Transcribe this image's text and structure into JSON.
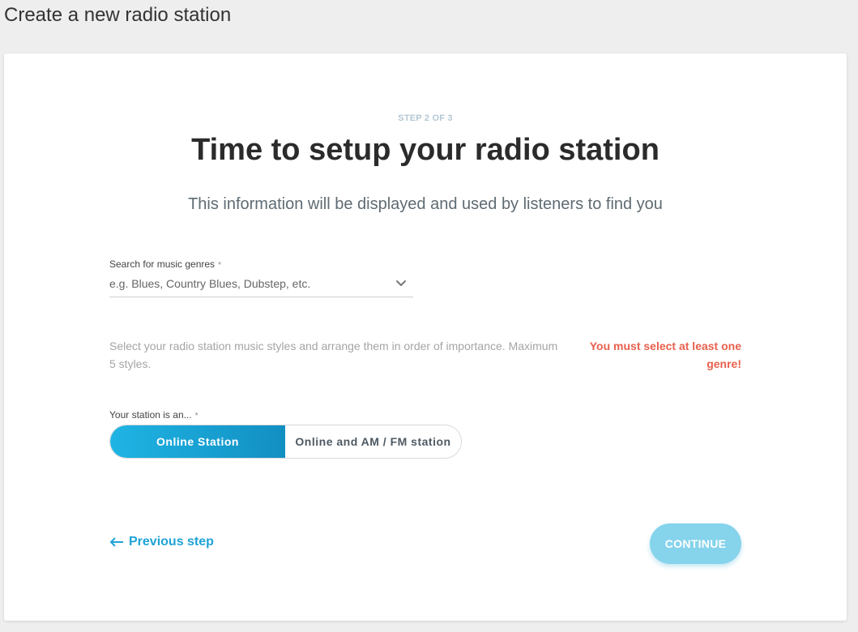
{
  "page": {
    "title": "Create a new radio station"
  },
  "wizard": {
    "step_label": "STEP 2 OF 3",
    "heading": "Time to setup your radio station",
    "subheading": "This information will be displayed and used by listeners to find you"
  },
  "genres": {
    "label": "Search for music genres",
    "required_marker": "*",
    "placeholder": "e.g. Blues, Country Blues, Dubstep, etc.",
    "value": "",
    "dropdown_icon": "chevron-down-icon",
    "help_text": "Select your radio station music styles and arrange them in order of importance. Maximum 5 styles.",
    "error_text": "You must select at least one genre!"
  },
  "station_type": {
    "label": "Your station is an...",
    "required_marker": "*",
    "options": [
      {
        "label": "Online Station",
        "selected": true
      },
      {
        "label": "Online and AM / FM station",
        "selected": false
      }
    ]
  },
  "navigation": {
    "previous_label": "Previous step",
    "previous_icon": "arrow-left-icon",
    "continue_label": "CONTINUE"
  },
  "colors": {
    "accent": "#1ea3d6",
    "error": "#e8604c",
    "continue_disabled": "#86d3ec",
    "selected_segment": "#1fb4e4"
  }
}
